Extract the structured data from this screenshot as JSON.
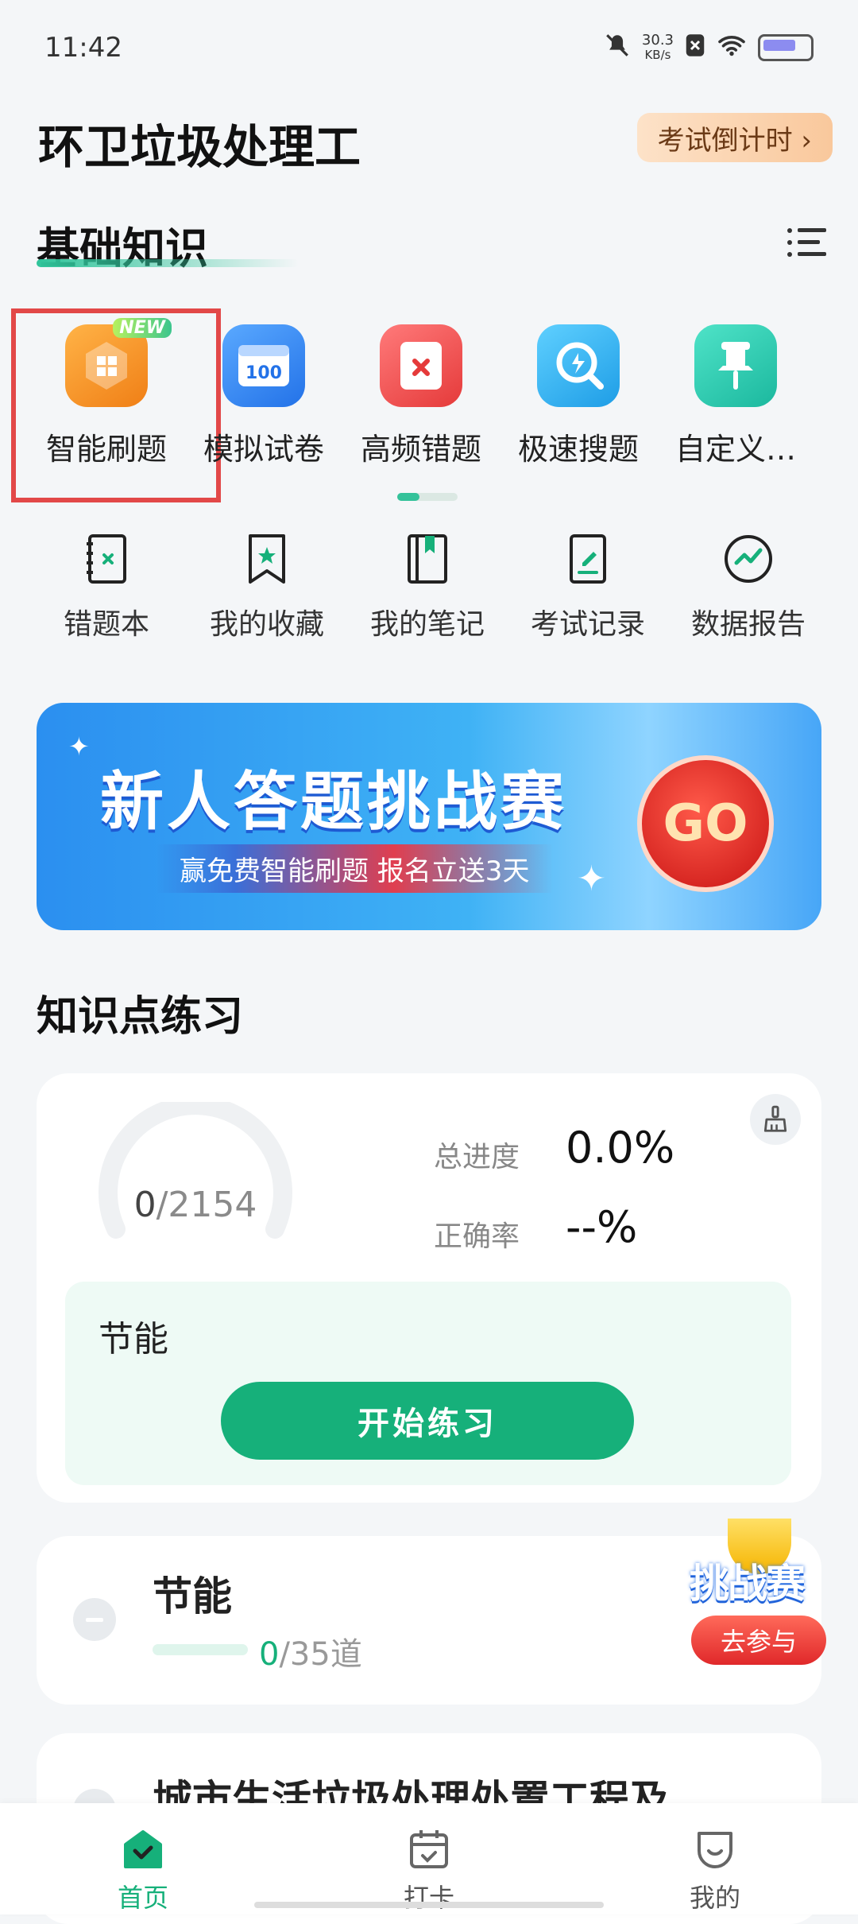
{
  "status_bar": {
    "time": "11:42",
    "net_speed_value": "30.3",
    "net_speed_unit": "KB/s"
  },
  "header": {
    "title": "环卫垃圾处理工",
    "countdown_label": "考试倒计时 ›"
  },
  "basic_section": {
    "title": "基础知识"
  },
  "features": [
    {
      "label": "智能刷题",
      "icon": "smart-practice-icon",
      "badge": "NEW",
      "color": "#f89a2a"
    },
    {
      "label": "模拟试卷",
      "icon": "mock-exam-icon",
      "badge_number": "100",
      "color": "#2f86f3"
    },
    {
      "label": "高频错题",
      "icon": "frequent-errors-icon",
      "color": "#f24c4c"
    },
    {
      "label": "极速搜题",
      "icon": "quick-search-icon",
      "color": "#2fb3f2"
    },
    {
      "label": "自定义…",
      "icon": "custom-pin-icon",
      "color": "#27c9b0"
    }
  ],
  "tools": [
    {
      "label": "错题本",
      "icon": "wrong-book-icon"
    },
    {
      "label": "我的收藏",
      "icon": "bookmark-icon"
    },
    {
      "label": "我的笔记",
      "icon": "notebook-icon"
    },
    {
      "label": "考试记录",
      "icon": "exam-record-icon"
    },
    {
      "label": "数据报告",
      "icon": "data-report-icon"
    }
  ],
  "banner": {
    "title": "新人答题挑战赛",
    "subtitle": "赢免费智能刷题  报名立送3天",
    "go_label": "GO"
  },
  "practice": {
    "section_title": "知识点练习",
    "done": "0",
    "total": "/2154",
    "progress_fraction": 0.0,
    "progress_label": "总进度",
    "progress_value": "0.0%",
    "accuracy_label": "正确率",
    "accuracy_value": "--%",
    "topic": "节能",
    "start_button": "开始练习"
  },
  "chapters": [
    {
      "title": "节能",
      "done": "0",
      "total": "/35道"
    },
    {
      "title": "城市生活垃圾处理处置工程及"
    }
  ],
  "challenge": {
    "title": "挑战赛",
    "button": "去参与"
  },
  "bottom_nav": [
    {
      "label": "首页",
      "icon": "home-icon",
      "active": true
    },
    {
      "label": "打卡",
      "icon": "calendar-check-icon"
    },
    {
      "label": "我的",
      "icon": "profile-icon"
    }
  ],
  "colors": {
    "accent": "#16b07a",
    "highlight": "#e24848"
  }
}
